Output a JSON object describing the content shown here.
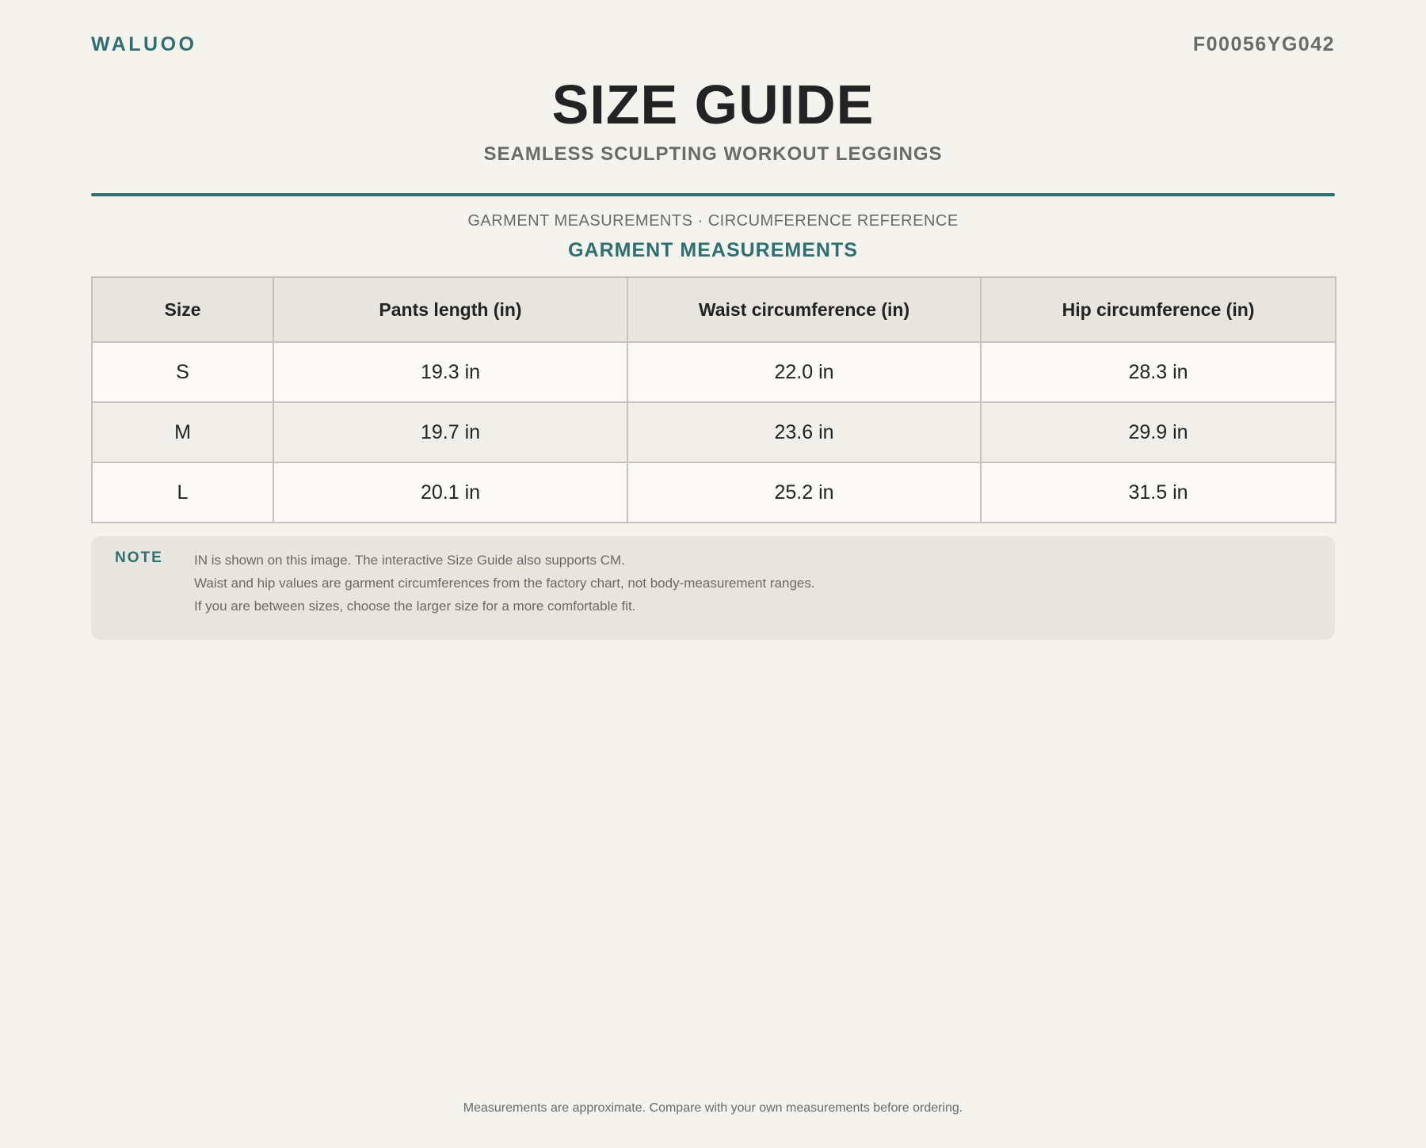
{
  "header": {
    "brand": "WALUOO",
    "sku": "F00056YG042",
    "title": "SIZE GUIDE",
    "subtitle": "SEAMLESS SCULPTING WORKOUT LEGGINGS"
  },
  "section": {
    "caption": "GARMENT MEASUREMENTS · CIRCUMFERENCE REFERENCE",
    "title": "GARMENT MEASUREMENTS"
  },
  "table": {
    "columns": [
      "Size",
      "Pants length (in)",
      "Waist circumference (in)",
      "Hip circumference (in)"
    ],
    "rows": [
      [
        "S",
        "19.3 in",
        "22.0 in",
        "28.3 in"
      ],
      [
        "M",
        "19.7 in",
        "23.6 in",
        "29.9 in"
      ],
      [
        "L",
        "20.1 in",
        "25.2 in",
        "31.5 in"
      ]
    ]
  },
  "note": {
    "label": "NOTE",
    "lines": [
      "IN is shown on this image. The interactive Size Guide also supports CM.",
      "Waist and hip values are garment circumferences from the factory chart, not body-measurement ranges.",
      "If you are between sizes, choose the larger size for a more comfortable fit."
    ]
  },
  "footer": {
    "text": "Measurements are approximate. Compare with your own measurements before ordering."
  },
  "colors": {
    "accent": "#2e6f70",
    "background": "#f4f3ee",
    "muted_text": "#6a6a66",
    "header_cell": "#e8e5df"
  }
}
